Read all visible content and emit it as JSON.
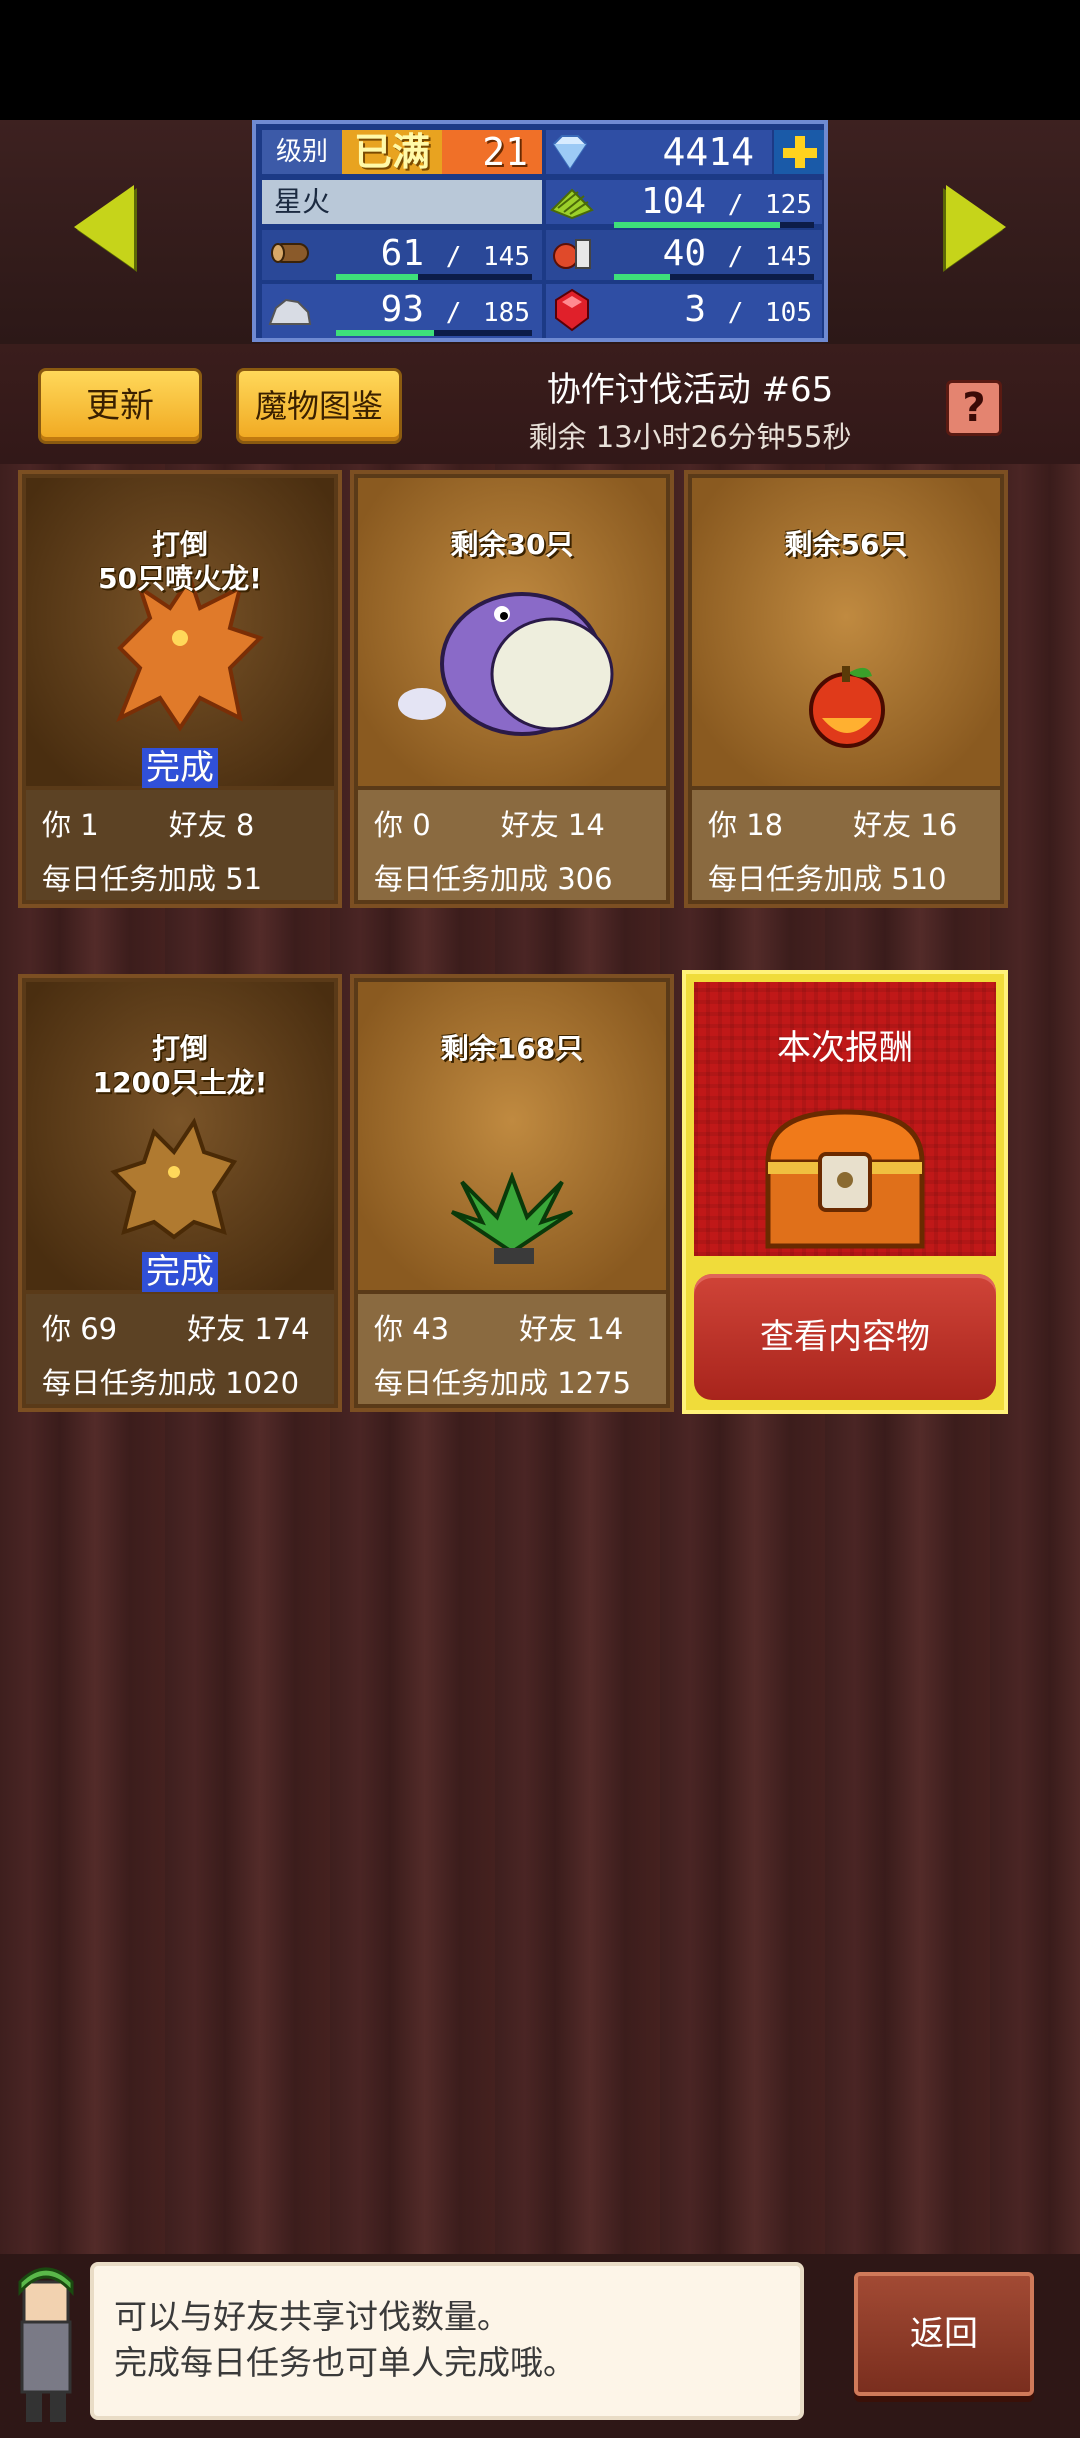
{
  "header": {
    "level_label": "级别",
    "level_max_badge": "已满",
    "level_value": "21",
    "gems": "4414",
    "town_name": "星火",
    "resources": {
      "grass": {
        "current": "104",
        "max": "125",
        "fill": 0.83
      },
      "wood": {
        "current": "61",
        "max": "145",
        "fill": 0.42
      },
      "food": {
        "current": "40",
        "max": "145",
        "fill": 0.28
      },
      "ore": {
        "current": "93",
        "max": "185",
        "fill": 0.5
      },
      "ruby": {
        "current": "3",
        "max": "105"
      }
    },
    "separator": "/"
  },
  "actions": {
    "refresh_label": "更新",
    "monster_book_label": "魔物图鉴",
    "help_label": "?"
  },
  "event": {
    "title": "协作讨伐活动 #65",
    "time_left": "剩余 13小时26分钟55秒"
  },
  "labels": {
    "you": "你",
    "friends": "好友",
    "daily_bonus": "每日任务加成",
    "done": "完成"
  },
  "cards": [
    {
      "title_line1": "打倒",
      "title_line2": "50只喷火龙!",
      "status": "done",
      "you": "1",
      "friends": "8",
      "bonus": "51"
    },
    {
      "title_line1": "剩余30只",
      "title_line2": "",
      "status": "active",
      "you": "0",
      "friends": "14",
      "bonus": "306"
    },
    {
      "title_line1": "剩余56只",
      "title_line2": "",
      "status": "active",
      "you": "18",
      "friends": "16",
      "bonus": "510"
    },
    {
      "title_line1": "打倒",
      "title_line2": "1200只土龙!",
      "status": "done",
      "you": "69",
      "friends": "174",
      "bonus": "1020"
    },
    {
      "title_line1": "剩余168只",
      "title_line2": "",
      "status": "active",
      "you": "43",
      "friends": "14",
      "bonus": "1275"
    }
  ],
  "reward": {
    "title": "本次报酬",
    "button_label": "查看内容物"
  },
  "footer": {
    "tip_line1": "可以与好友共享讨伐数量。",
    "tip_line2": "完成每日任务也可单人完成哦。",
    "back_label": "返回"
  },
  "colors": {
    "wood_dark": "#3e1f1e",
    "stats_blue": "#1c3a86",
    "gold_button": "#f0a820",
    "reward_red": "#c01818",
    "bar_green": "#3ee07a"
  }
}
